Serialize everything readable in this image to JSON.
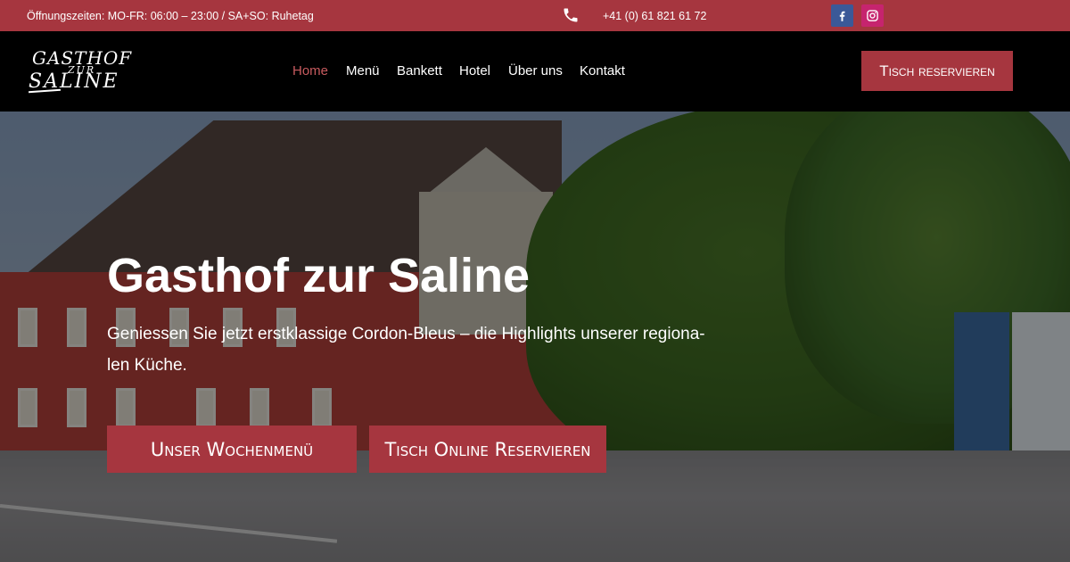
{
  "topbar": {
    "hours": "Öffnungszeiten: MO-FR: 06:00 – 23:00 / SA+SO: Ruhetag",
    "phone": "+41 (0) 61 821 61 72",
    "icons": {
      "phone": "phone-icon",
      "facebook": "facebook-icon",
      "instagram": "instagram-icon"
    },
    "colors": {
      "bar": "#a6363f",
      "facebook": "#3b5998",
      "instagram": "#c6246e"
    }
  },
  "header": {
    "logo": {
      "line1": "GASTHOF",
      "line2": "ZUR",
      "line3": "SALINE"
    },
    "nav": [
      {
        "label": "Home",
        "active": true
      },
      {
        "label": "Menü"
      },
      {
        "label": "Bankett"
      },
      {
        "label": "Hotel"
      },
      {
        "label": "Über uns"
      },
      {
        "label": "Kontakt"
      }
    ],
    "cta": "Tisch reservieren",
    "colors": {
      "background": "#000000",
      "active_link": "#c85b5f",
      "cta": "#a6363f"
    }
  },
  "hero": {
    "title": "Gasthof zur Saline",
    "subtitle": "Geniessen Sie jetzt erstklassige Cordon-Bleus – die Highlights unserer regiona-len Küche.",
    "buttons": {
      "menu": "Unser Wochenmenü",
      "reserve": "Tisch Online Reservieren"
    },
    "colors": {
      "button": "#a6363f",
      "text": "#ffffff"
    }
  }
}
